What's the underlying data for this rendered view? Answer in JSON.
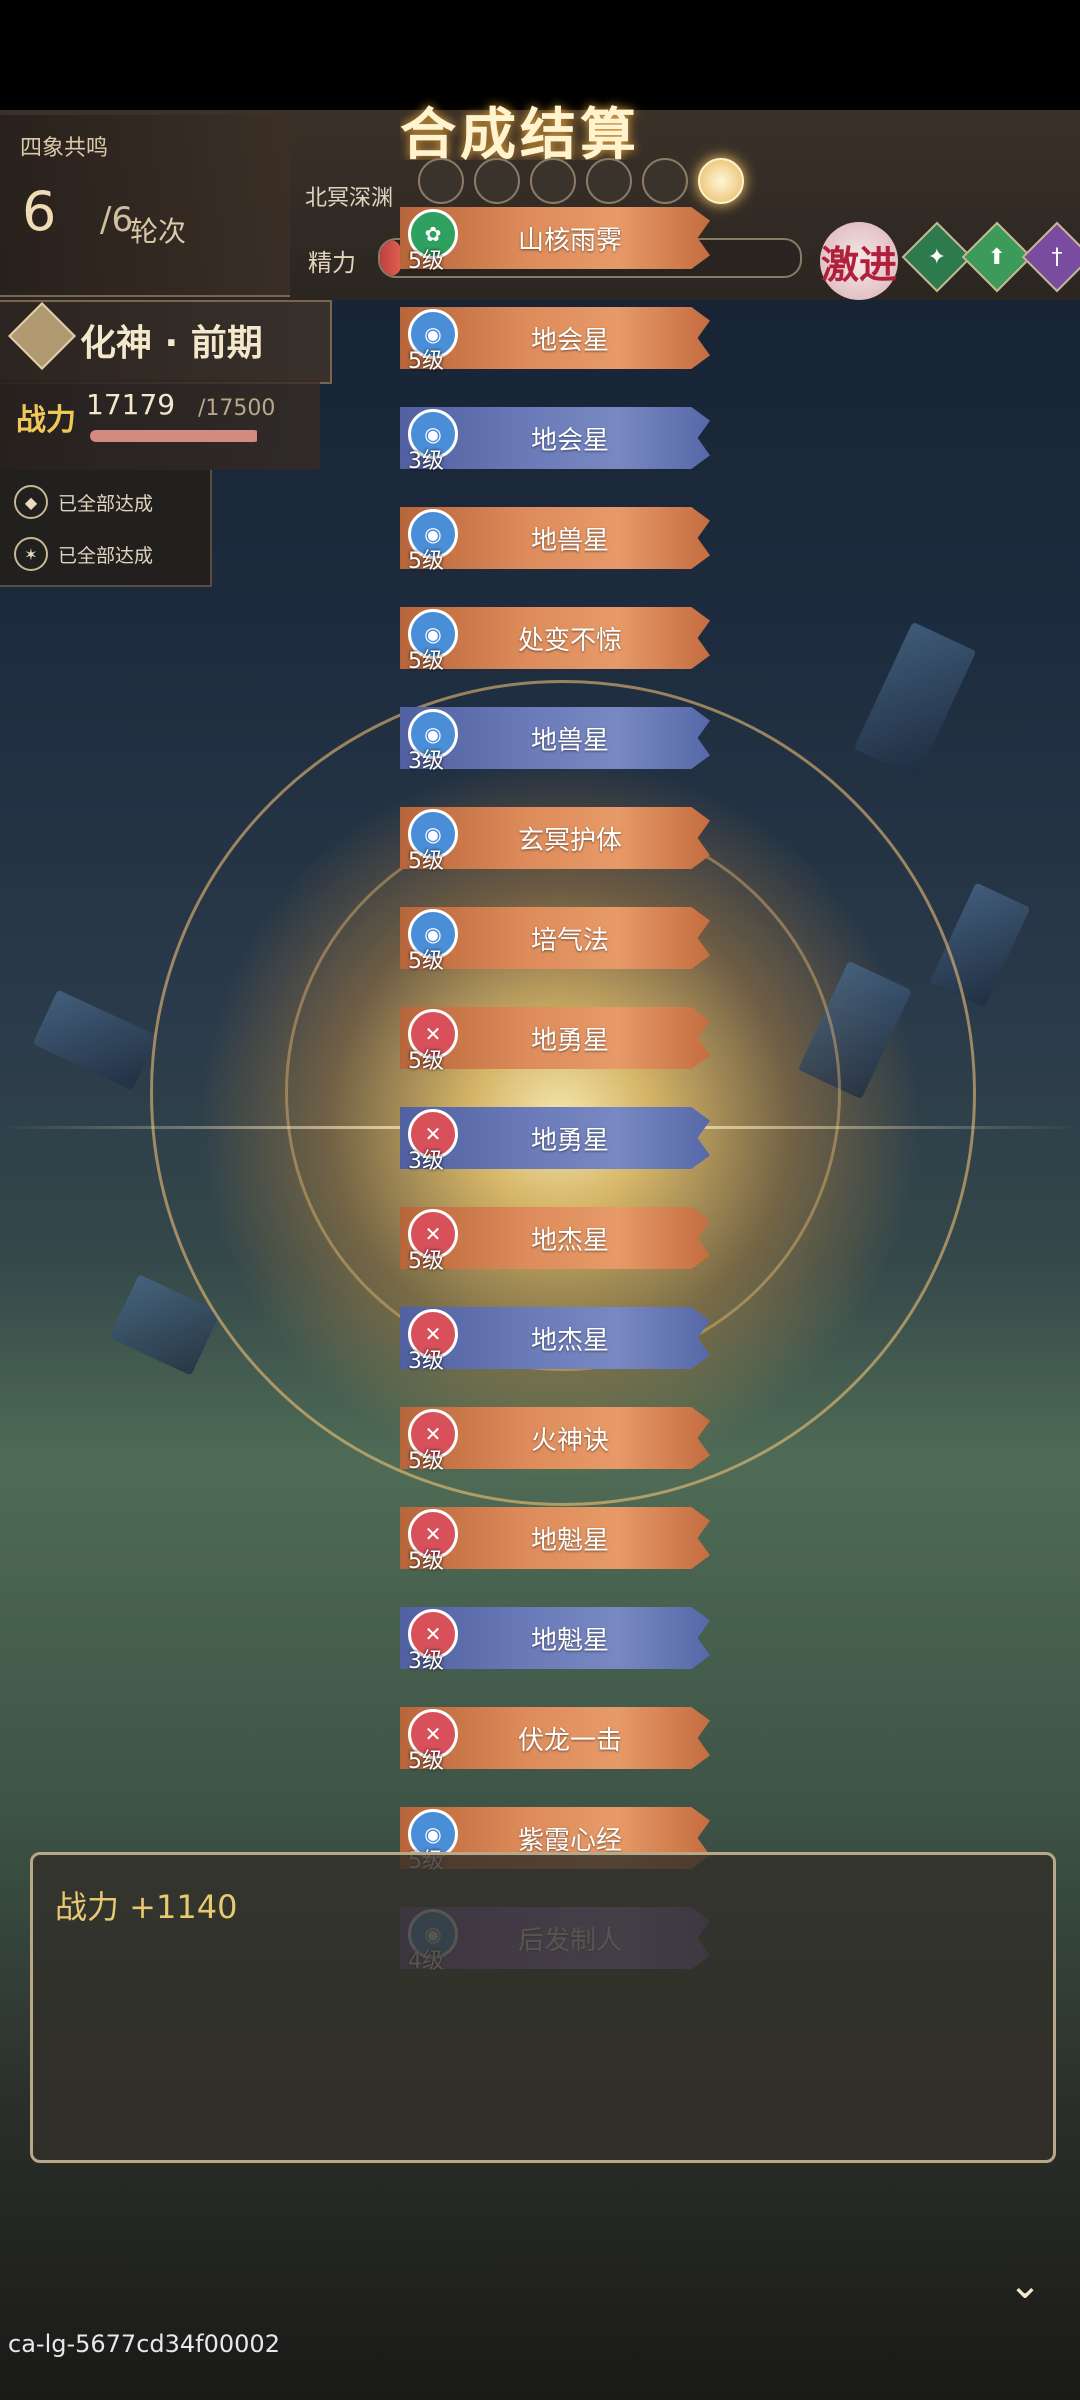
{
  "header": {
    "title": "合成结算",
    "resonance_title": "四象共鸣",
    "round_current": "6",
    "round_total": "/6",
    "round_label": "轮次",
    "location": "北冥深渊",
    "energy_label": "精力",
    "energy_fill_fraction": 0.05,
    "stimulate_label": "激进",
    "bead_count_visible": 6
  },
  "status_icons": [
    "shuriken-icon",
    "arrow-up-icon",
    "sword-icon"
  ],
  "realm": {
    "text": "化神 · 前期"
  },
  "power": {
    "label": "战力",
    "value": "17179",
    "max": "/17500",
    "fill_fraction": 0.98
  },
  "achievements": [
    {
      "label": "已全部达成",
      "icon": "shield-icon",
      "glyph": "◆"
    },
    {
      "label": "已全部达成",
      "icon": "spider-icon",
      "glyph": "✶"
    }
  ],
  "results": [
    {
      "name": "山核雨霁",
      "level": "5级",
      "tier": "orange",
      "icon": "green"
    },
    {
      "name": "地会星",
      "level": "5级",
      "tier": "orange",
      "icon": "blue"
    },
    {
      "name": "地会星",
      "level": "3级",
      "tier": "blue",
      "icon": "blue"
    },
    {
      "name": "地兽星",
      "level": "5级",
      "tier": "orange",
      "icon": "blue"
    },
    {
      "name": "处变不惊",
      "level": "5级",
      "tier": "orange",
      "icon": "blue"
    },
    {
      "name": "地兽星",
      "level": "3级",
      "tier": "blue",
      "icon": "blue"
    },
    {
      "name": "玄冥护体",
      "level": "5级",
      "tier": "orange",
      "icon": "blue"
    },
    {
      "name": "培气法",
      "level": "5级",
      "tier": "orange",
      "icon": "blue"
    },
    {
      "name": "地勇星",
      "level": "5级",
      "tier": "orange",
      "icon": "red"
    },
    {
      "name": "地勇星",
      "level": "3级",
      "tier": "blue",
      "icon": "red"
    },
    {
      "name": "地杰星",
      "level": "5级",
      "tier": "orange",
      "icon": "red"
    },
    {
      "name": "地杰星",
      "level": "3级",
      "tier": "blue",
      "icon": "red"
    },
    {
      "name": "火神诀",
      "level": "5级",
      "tier": "orange",
      "icon": "red"
    },
    {
      "name": "地魁星",
      "level": "5级",
      "tier": "orange",
      "icon": "red"
    },
    {
      "name": "地魁星",
      "level": "3级",
      "tier": "blue",
      "icon": "red"
    },
    {
      "name": "伏龙一击",
      "level": "5级",
      "tier": "orange",
      "icon": "red"
    },
    {
      "name": "紫霞心经",
      "level": "5级",
      "tier": "orange",
      "icon": "blue"
    },
    {
      "name": "后发制人",
      "level": "4级",
      "tier": "purple",
      "icon": "blue"
    }
  ],
  "bottom": {
    "power_gain": "战力   +1140"
  },
  "watermark": "ca-lg-5677cd34f00002"
}
